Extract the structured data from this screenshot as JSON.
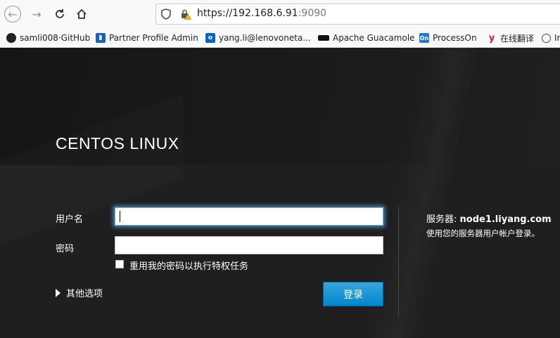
{
  "browser": {
    "url_main": "https://192.168.6.91",
    "url_port": ":9090",
    "bookmarks": [
      {
        "label": "samli008·GitHub",
        "icon": "github-icon",
        "color": "#222222"
      },
      {
        "label": "Partner Profile Admin",
        "icon": "partner-icon",
        "color": "#1565c0"
      },
      {
        "label": "yang.li@lenovoneta...",
        "icon": "outlook-icon",
        "color": "#0a64c8"
      },
      {
        "label": "Apache Guacamole",
        "icon": "guacamole-icon",
        "color": "#111111"
      },
      {
        "label": "ProcessOn",
        "icon": "processon-icon",
        "color": "#1f7ad1"
      },
      {
        "label": "在线翻译",
        "icon": "youdao-icon",
        "color": "#e0162b"
      },
      {
        "label": "In",
        "icon": "globe-icon",
        "color": "#444444"
      }
    ]
  },
  "login": {
    "brand": "CENTOS LINUX",
    "username_label": "用户名",
    "username_value": "",
    "password_label": "密码",
    "password_value": "",
    "reuse_password_label": "重用我的密码以执行特权任务",
    "other_options_label": "其他选项",
    "login_button": "登录",
    "server_label": "服务器: ",
    "server_host": "node1.liyang.com",
    "server_hint": "使用您的服务器用户帐户登录。"
  }
}
